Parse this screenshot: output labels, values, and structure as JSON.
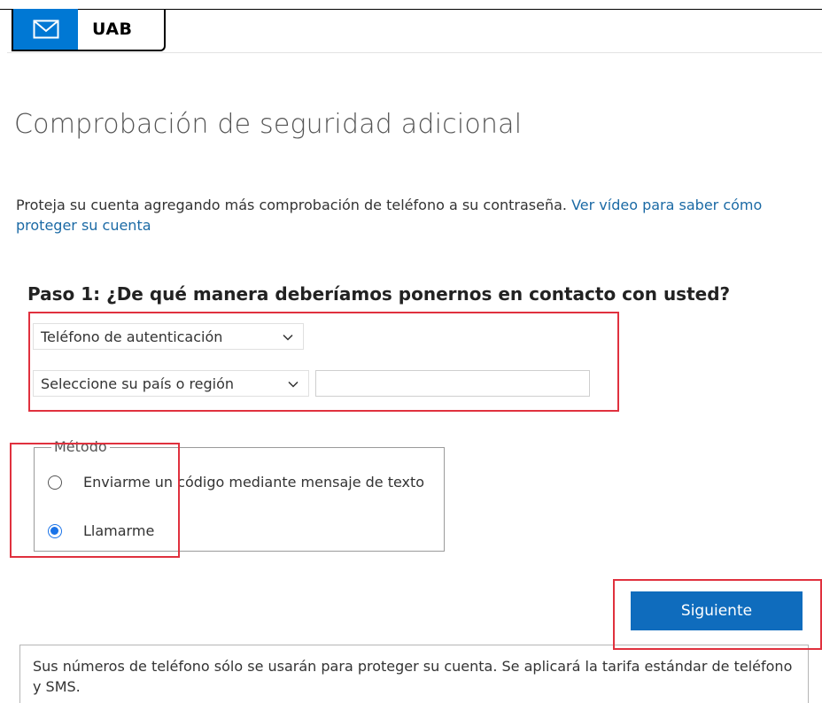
{
  "header": {
    "mail_icon": "mail-icon",
    "brand_text": "UAB",
    "accent": "#0078d4"
  },
  "page": {
    "title": "Comprobación de seguridad adicional",
    "intro_text": "Proteja su cuenta agregando más comprobación de teléfono a su contraseña. ",
    "intro_link": "Ver vídeo para saber cómo proteger su cuenta"
  },
  "step1": {
    "heading": "Paso 1: ¿De qué manera deberíamos ponernos en contacto con usted?",
    "contact_select": "Teléfono de autenticación",
    "country_select": "Seleccione su país o región",
    "phone_value": ""
  },
  "method": {
    "legend": "Método",
    "options": [
      {
        "label": "Enviarme un código mediante mensaje de texto",
        "checked": false
      },
      {
        "label": "Llamarme",
        "checked": true
      }
    ]
  },
  "actions": {
    "next_label": "Siguiente",
    "next_color": "#0f6cbd"
  },
  "note": {
    "text": "Sus números de teléfono sólo se usarán para proteger su cuenta. Se aplicará la tarifa estándar de teléfono y SMS."
  },
  "highlight_color": "#e0313e"
}
